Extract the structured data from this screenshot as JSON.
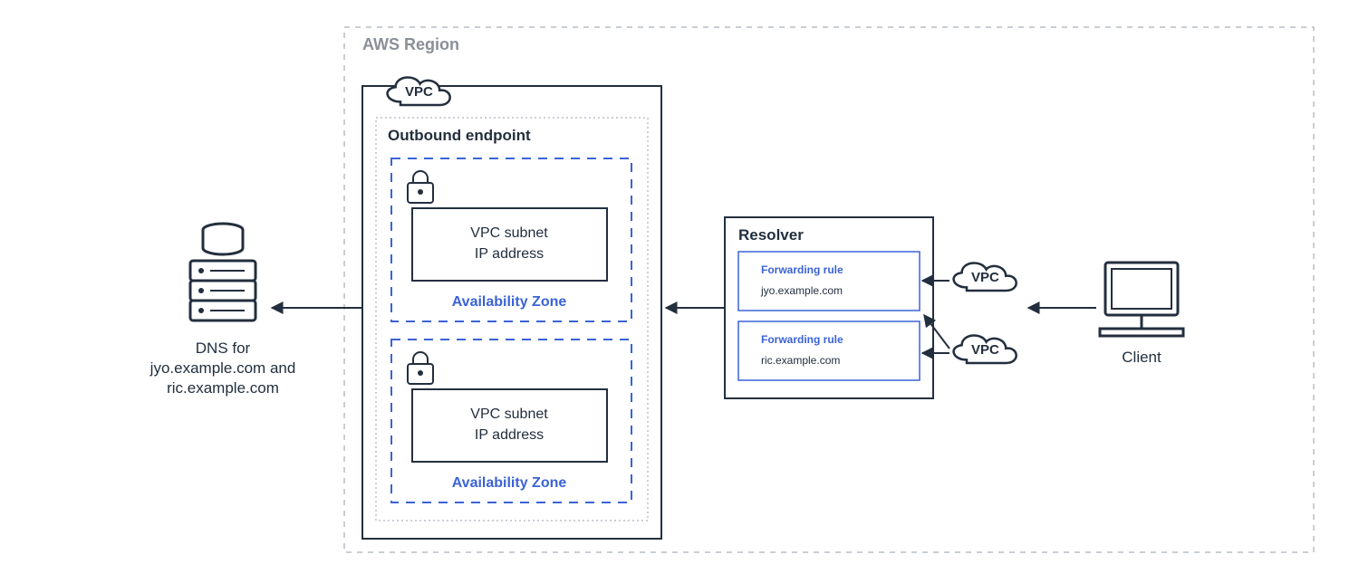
{
  "region": {
    "label": "AWS Region"
  },
  "vpc_left": {
    "label": "VPC"
  },
  "outbound": {
    "label": "Outbound endpoint",
    "az1": {
      "ip_line1": "VPC subnet",
      "ip_line2": "IP address",
      "az_label": "Availability Zone"
    },
    "az2": {
      "ip_line1": "VPC subnet",
      "ip_line2": "IP address",
      "az_label": "Availability Zone"
    }
  },
  "resolver": {
    "label": "Resolver",
    "rule1": {
      "title": "Forwarding rule",
      "domain": "jyo.example.com"
    },
    "rule2": {
      "title": "Forwarding rule",
      "domain": "ric.example.com"
    },
    "vpc1_label": "VPC",
    "vpc2_label": "VPC"
  },
  "dns": {
    "line1": "DNS for",
    "line2": "jyo.example.com and",
    "line3": "ric.example.com"
  },
  "client": {
    "label": "Client"
  }
}
